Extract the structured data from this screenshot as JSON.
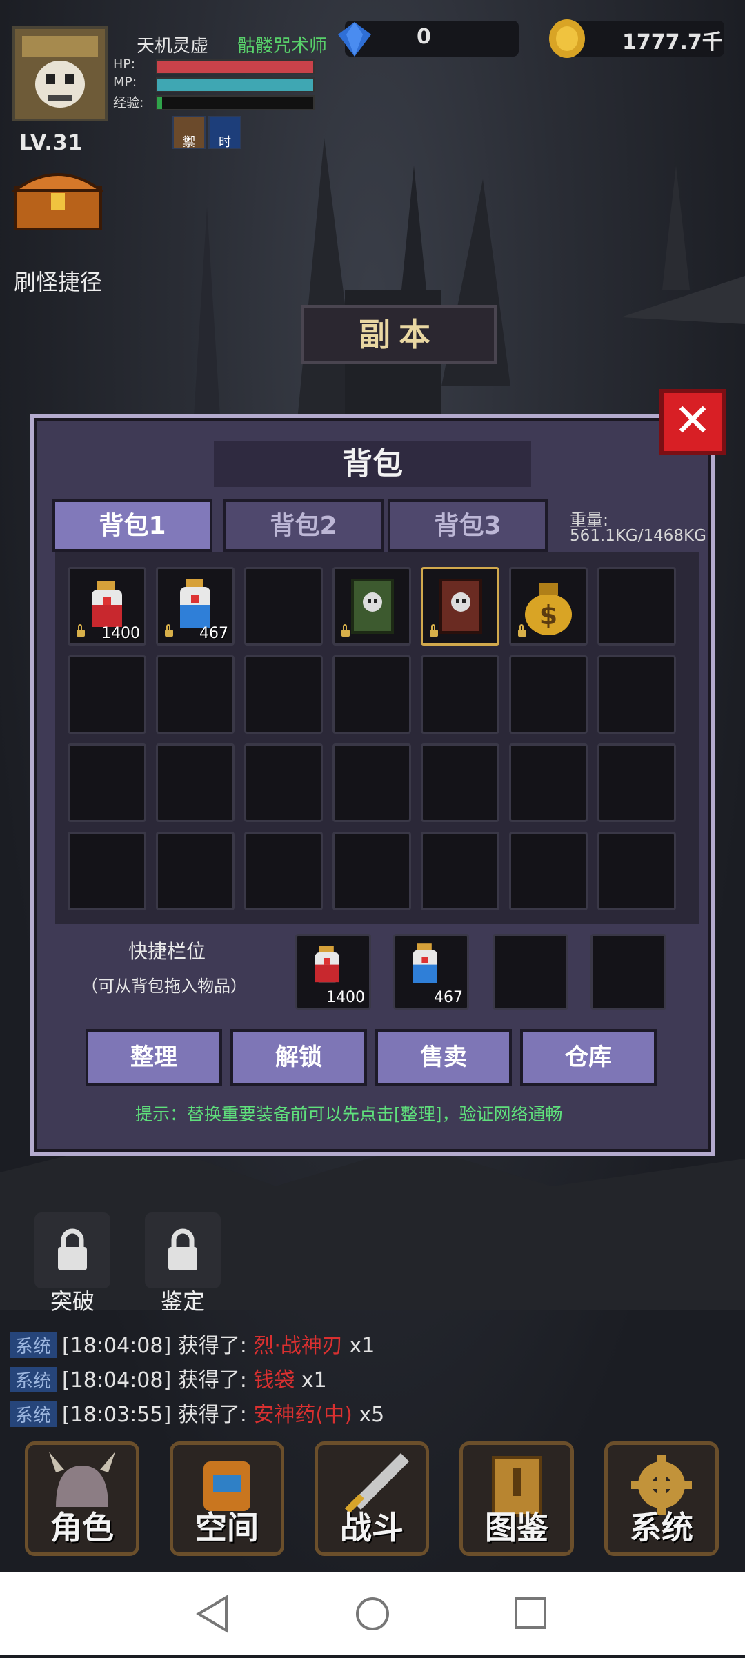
{
  "player": {
    "name": "天机灵虚",
    "class": "骷髅咒术师",
    "level": "LV.31",
    "hp_label": "HP:",
    "mp_label": "MP:",
    "exp_label": "经验:",
    "hp_fraction": 1.0,
    "mp_fraction": 1.0,
    "exp_fraction": 0.03,
    "buffs": [
      "禦",
      "时"
    ]
  },
  "currency": {
    "gems": "0",
    "gold": "1777.7千"
  },
  "hud": {
    "shortcut_label": "刷怪捷径",
    "dungeon_label": "副本"
  },
  "bag": {
    "title": "背包",
    "tabs": [
      "背包1",
      "背包2",
      "背包3"
    ],
    "weight_label": "重量:",
    "weight_value": "561.1KG/1468KG",
    "slots": [
      {
        "item": "red-potion-icon",
        "count": "1400",
        "locked": true
      },
      {
        "item": "blue-potion-icon",
        "count": "467",
        "locked": true
      },
      {
        "item": "",
        "count": "",
        "locked": false
      },
      {
        "item": "skull-book-green-icon",
        "count": "",
        "locked": true
      },
      {
        "item": "skull-book-red-icon",
        "count": "",
        "locked": true,
        "selected": true
      },
      {
        "item": "money-bag-icon",
        "count": "",
        "locked": true
      },
      {
        "item": "",
        "count": "",
        "locked": false
      }
    ],
    "quick_title": "快捷栏位",
    "quick_sub": "（可从背包拖入物品）",
    "quick_slots": [
      {
        "item": "red-potion-icon",
        "count": "1400"
      },
      {
        "item": "blue-potion-icon",
        "count": "467"
      },
      {
        "item": "",
        "count": ""
      },
      {
        "item": "",
        "count": ""
      }
    ],
    "actions": [
      "整理",
      "解锁",
      "售卖",
      "仓库"
    ],
    "hint": "提示：替换重要装备前可以先点击[整理]，验证网络通畅"
  },
  "lower": {
    "breakthrough": "突破",
    "appraise": "鉴定"
  },
  "chat": [
    {
      "tag": "系统",
      "time": "[18:04:08]",
      "text": "获得了:",
      "item": "烈·战神刃",
      "qty": "x1"
    },
    {
      "tag": "系统",
      "time": "[18:04:08]",
      "text": "获得了:",
      "item": "钱袋",
      "qty": "x1"
    },
    {
      "tag": "系统",
      "time": "[18:03:55]",
      "text": "获得了:",
      "item": "安神药(中)",
      "qty": "x5"
    }
  ],
  "nav": [
    "角色",
    "空间",
    "战斗",
    "图鉴",
    "系统"
  ]
}
